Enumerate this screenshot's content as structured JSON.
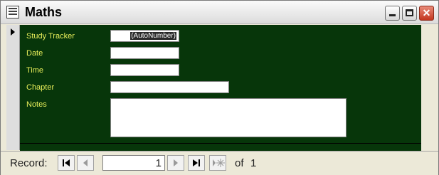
{
  "window": {
    "title": "Maths",
    "icon": "datasheet-table-icon",
    "controls": [
      "minimize-icon",
      "maximize-icon",
      "close-icon"
    ]
  },
  "form": {
    "fields": [
      {
        "label": "Study Tracker",
        "value": "(AutoNumber)"
      },
      {
        "label": "Date",
        "value": ""
      },
      {
        "label": "Time",
        "value": ""
      },
      {
        "label": "Chapter",
        "value": ""
      },
      {
        "label": "Notes",
        "value": ""
      }
    ],
    "colors": {
      "background": "#07360a",
      "label": "#e8ee5a"
    }
  },
  "navigation": {
    "label": "Record:",
    "current_record": "1",
    "of_label": "of",
    "total_records": "1",
    "buttons": [
      "first-record-icon",
      "previous-record-icon",
      "next-record-icon",
      "last-record-icon",
      "new-record-icon"
    ]
  }
}
